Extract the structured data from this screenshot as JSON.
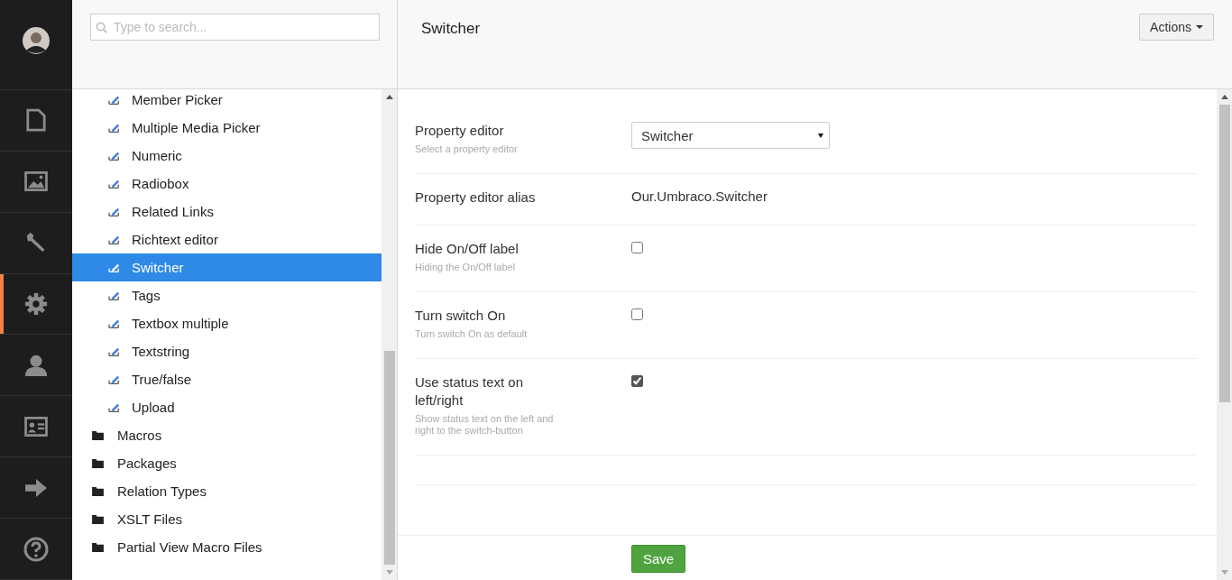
{
  "nav": [
    {
      "kind": "avatar",
      "selected": false
    },
    {
      "kind": "content",
      "selected": false
    },
    {
      "kind": "media",
      "selected": false
    },
    {
      "kind": "developer",
      "selected": false
    },
    {
      "kind": "settings",
      "selected": true
    },
    {
      "kind": "users",
      "selected": false
    },
    {
      "kind": "members",
      "selected": false
    },
    {
      "kind": "forms",
      "selected": false
    },
    {
      "kind": "help",
      "selected": false
    }
  ],
  "search": {
    "placeholder": "Type to search..."
  },
  "tree": [
    {
      "label": "Member Picker",
      "kind": "data-type",
      "selected": false
    },
    {
      "label": "Multiple Media Picker",
      "kind": "data-type",
      "selected": false
    },
    {
      "label": "Numeric",
      "kind": "data-type",
      "selected": false
    },
    {
      "label": "Radiobox",
      "kind": "data-type",
      "selected": false
    },
    {
      "label": "Related Links",
      "kind": "data-type",
      "selected": false
    },
    {
      "label": "Richtext editor",
      "kind": "data-type",
      "selected": false
    },
    {
      "label": "Switcher",
      "kind": "data-type",
      "selected": true
    },
    {
      "label": "Tags",
      "kind": "data-type",
      "selected": false
    },
    {
      "label": "Textbox multiple",
      "kind": "data-type",
      "selected": false
    },
    {
      "label": "Textstring",
      "kind": "data-type",
      "selected": false
    },
    {
      "label": "True/false",
      "kind": "data-type",
      "selected": false
    },
    {
      "label": "Upload",
      "kind": "data-type",
      "selected": false
    },
    {
      "label": "Macros",
      "kind": "folder",
      "selected": false
    },
    {
      "label": "Packages",
      "kind": "folder",
      "selected": false
    },
    {
      "label": "Relation Types",
      "kind": "folder",
      "selected": false
    },
    {
      "label": "XSLT Files",
      "kind": "folder",
      "selected": false
    },
    {
      "label": "Partial View Macro Files",
      "kind": "folder",
      "selected": false
    }
  ],
  "editor": {
    "title": "Switcher",
    "actions_button": "Actions",
    "save_button": "Save",
    "properties": [
      {
        "kind": "select",
        "label": "Property editor",
        "description": "Select a property editor",
        "value": "Switcher"
      },
      {
        "kind": "text",
        "label": "Property editor alias",
        "value": "Our.Umbraco.Switcher"
      },
      {
        "kind": "checkbox",
        "label": "Hide On/Off label",
        "description": "Hiding the On/Off label",
        "checked": false
      },
      {
        "kind": "checkbox",
        "label": "Turn switch On",
        "description": "Turn switch On as default",
        "checked": false
      },
      {
        "kind": "checkbox",
        "label": "Use status text on left/right",
        "description": "Show status text on the left and right to the switch-button",
        "checked": true
      }
    ]
  }
}
